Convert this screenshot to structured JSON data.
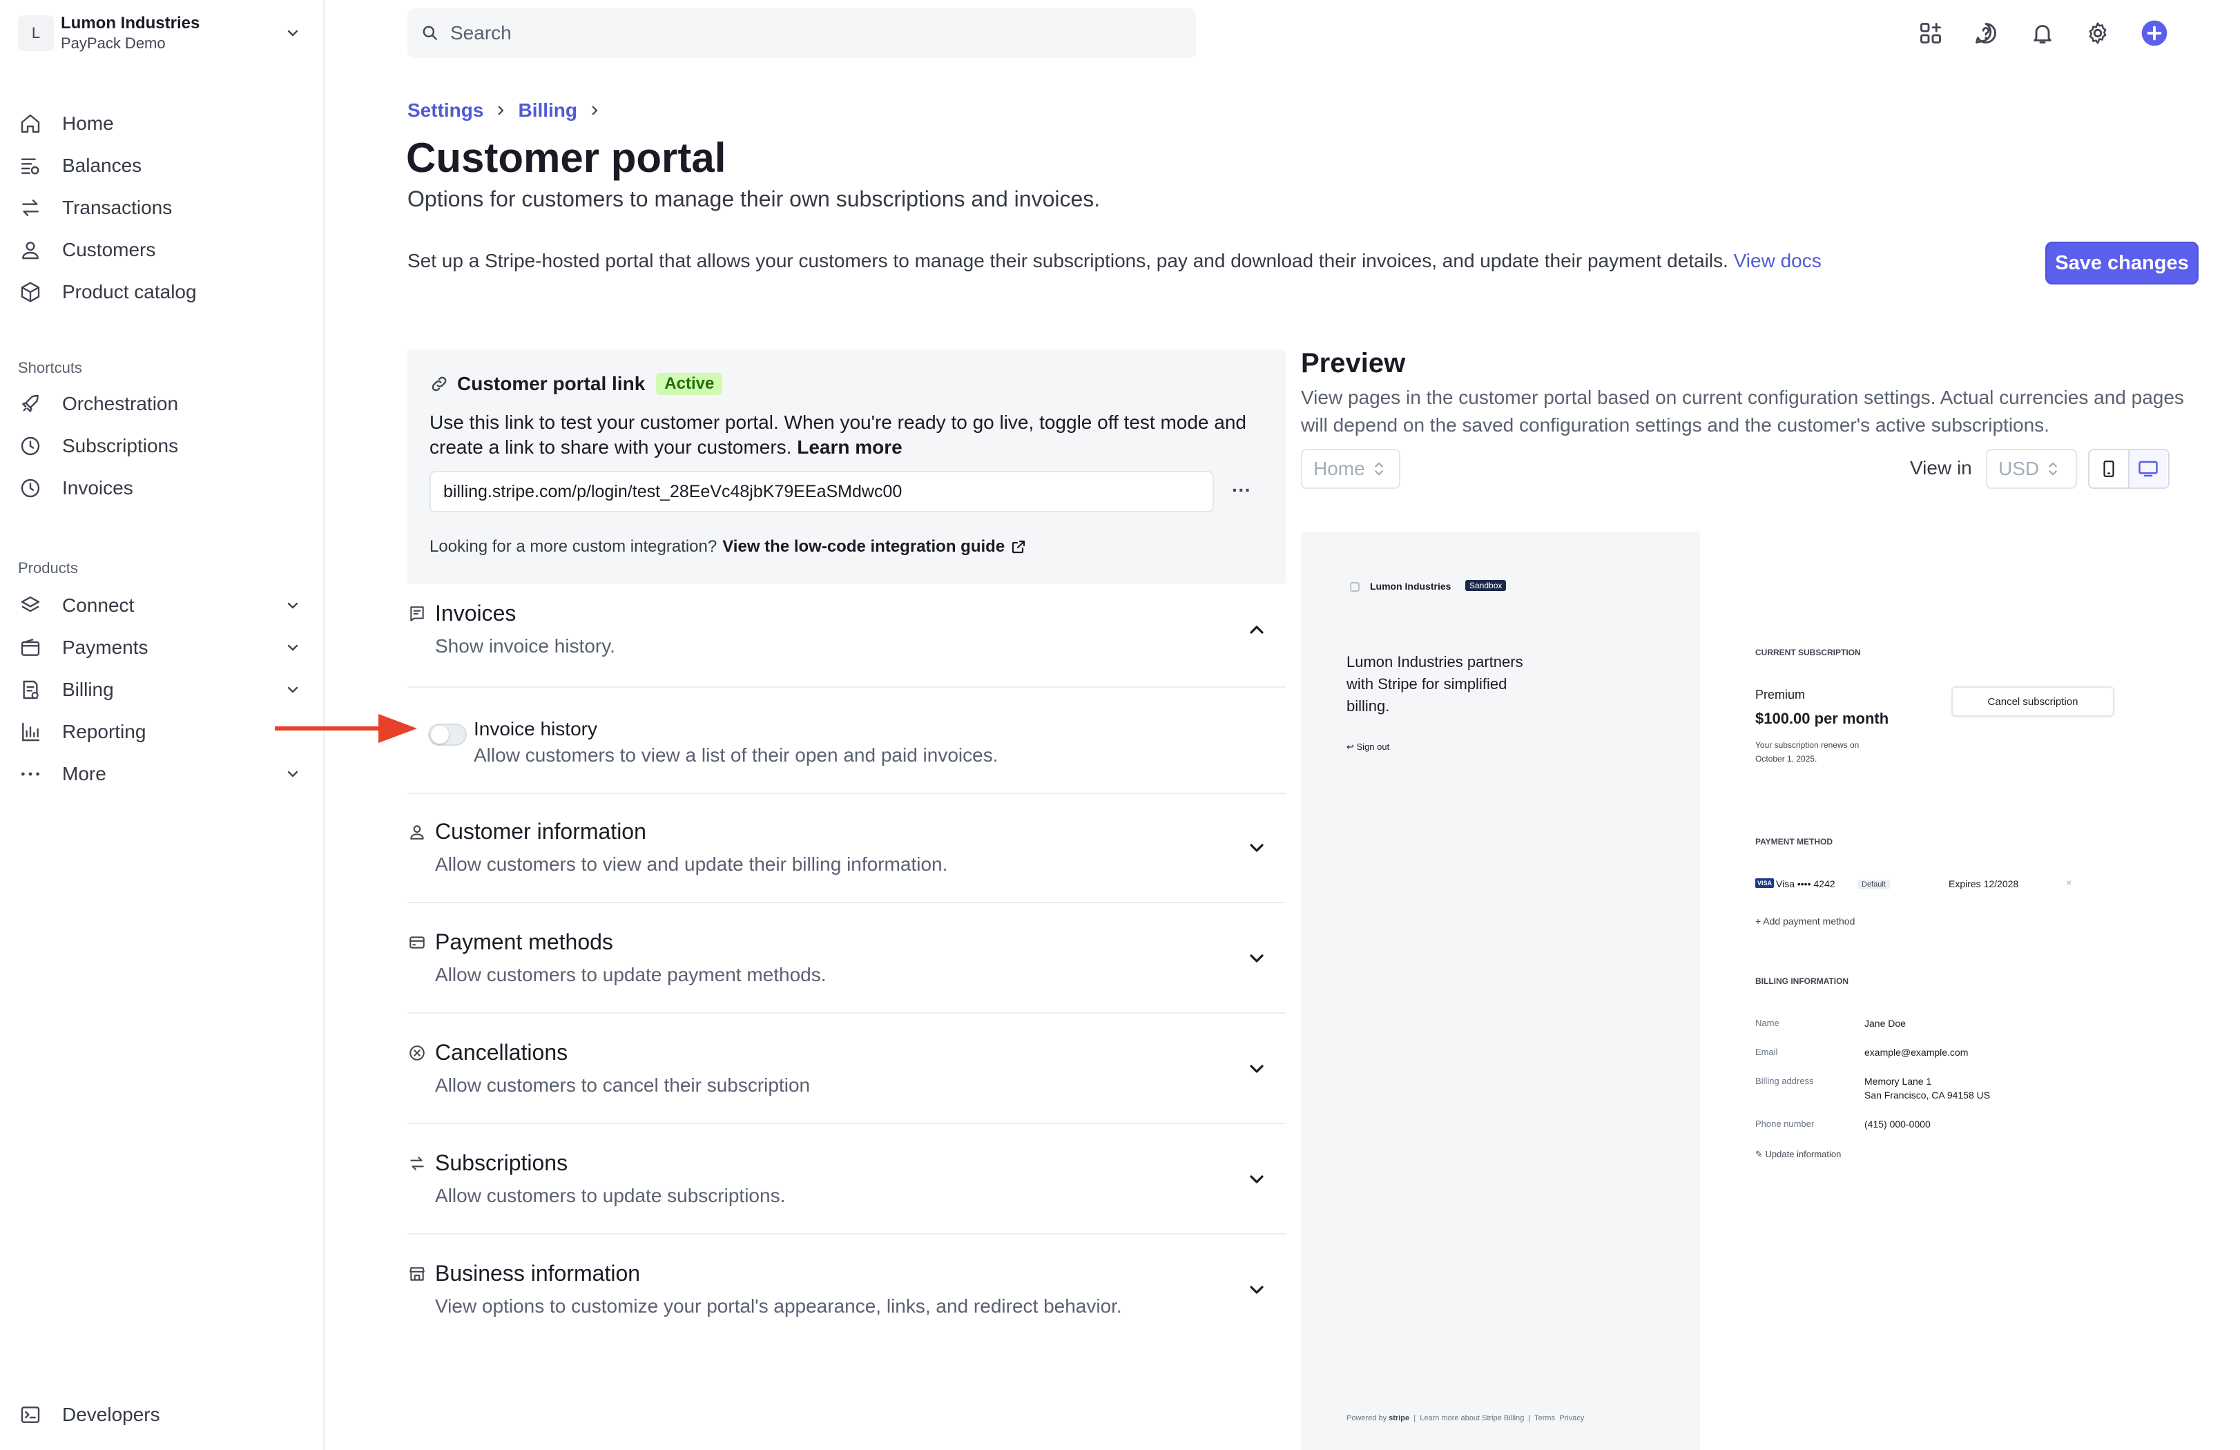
{
  "account": {
    "initial": "L",
    "org": "Lumon Industries",
    "sub": "PayPack Demo"
  },
  "nav": {
    "main": [
      {
        "label": "Home"
      },
      {
        "label": "Balances"
      },
      {
        "label": "Transactions"
      },
      {
        "label": "Customers"
      },
      {
        "label": "Product catalog"
      }
    ],
    "shortcuts_title": "Shortcuts",
    "shortcuts": [
      {
        "label": "Orchestration"
      },
      {
        "label": "Subscriptions"
      },
      {
        "label": "Invoices"
      }
    ],
    "products_title": "Products",
    "products": [
      {
        "label": "Connect"
      },
      {
        "label": "Payments"
      },
      {
        "label": "Billing"
      },
      {
        "label": "Reporting"
      },
      {
        "label": "More"
      }
    ],
    "developers": "Developers"
  },
  "search": {
    "placeholder": "Search"
  },
  "breadcrumb": {
    "item1": "Settings",
    "item2": "Billing"
  },
  "page": {
    "title": "Customer portal",
    "subtitle": "Options for customers to manage their own subscriptions and invoices.",
    "intro": "Set up a Stripe-hosted portal that allows your customers to manage their subscriptions, pay and download their invoices, and update their payment details.",
    "intro_link": "View docs",
    "save": "Save changes"
  },
  "portal_link": {
    "title": "Customer portal link",
    "badge": "Active",
    "desc": "Use this link to test your customer portal. When you're ready to go live, toggle off test mode and create a link to share with your customers.",
    "learn_more": "Learn more",
    "url": "billing.stripe.com/p/login/test_28EeVc48jbK79EEaSMdwc00",
    "more": "···",
    "footer": "Looking for a more custom integration?",
    "footer_link": "View the low-code integration guide"
  },
  "sections": {
    "invoices": {
      "title": "Invoices",
      "desc": "Show invoice history."
    },
    "invoice_history": {
      "title": "Invoice history",
      "desc": "Allow customers to view a list of their open and paid invoices.",
      "enabled": false
    },
    "customer_info": {
      "title": "Customer information",
      "desc": "Allow customers to view and update their billing information."
    },
    "payment_methods": {
      "title": "Payment methods",
      "desc": "Allow customers to update payment methods."
    },
    "cancellations": {
      "title": "Cancellations",
      "desc": "Allow customers to cancel their subscription"
    },
    "subscriptions": {
      "title": "Subscriptions",
      "desc": "Allow customers to update subscriptions."
    },
    "business_info": {
      "title": "Business information",
      "desc": "View options to customize your portal's appearance, links, and redirect behavior."
    }
  },
  "preview": {
    "title": "Preview",
    "desc": "View pages in the customer portal based on current configuration settings. Actual currencies and pages will depend on the saved configuration settings and the customer's active subscriptions.",
    "page_select": "Home",
    "view_in": "View in",
    "currency": "USD",
    "portal": {
      "brand": "Lumon Industries",
      "sandbox": "Sandbox",
      "tagline_1": "Lumon Industries partners",
      "tagline_2": "with Stripe for simplified",
      "tagline_3": "billing.",
      "sign_out": "Sign out",
      "current_sub_label": "CURRENT SUBSCRIPTION",
      "plan": "Premium",
      "price": "$100.00 per month",
      "renew_1": "Your subscription renews on",
      "renew_2": "October 1, 2025.",
      "cancel": "Cancel subscription",
      "pm_label": "PAYMENT METHOD",
      "card_brand": "VISA",
      "card": "Visa •••• 4242",
      "default": "Default",
      "expires": "Expires 12/2028",
      "add_pm": "Add payment method",
      "billing_label": "BILLING INFORMATION",
      "name_k": "Name",
      "name_v": "Jane Doe",
      "email_k": "Email",
      "email_v": "example@example.com",
      "addr_k": "Billing address",
      "addr_v1": "Memory Lane 1",
      "addr_v2": "San Francisco, CA 94158 US",
      "phone_k": "Phone number",
      "phone_v": "(415) 000-0000",
      "update": "Update information",
      "powered": "Powered by",
      "powered_brand": "stripe",
      "learn": "Learn more about Stripe Billing",
      "terms": "Terms",
      "privacy": "Privacy"
    }
  },
  "colors": {
    "accent": "#5a5fec",
    "link": "#4f5bd5",
    "active_bg": "#d1fab3",
    "active_fg": "#217005",
    "arrow": "#e8402a"
  }
}
